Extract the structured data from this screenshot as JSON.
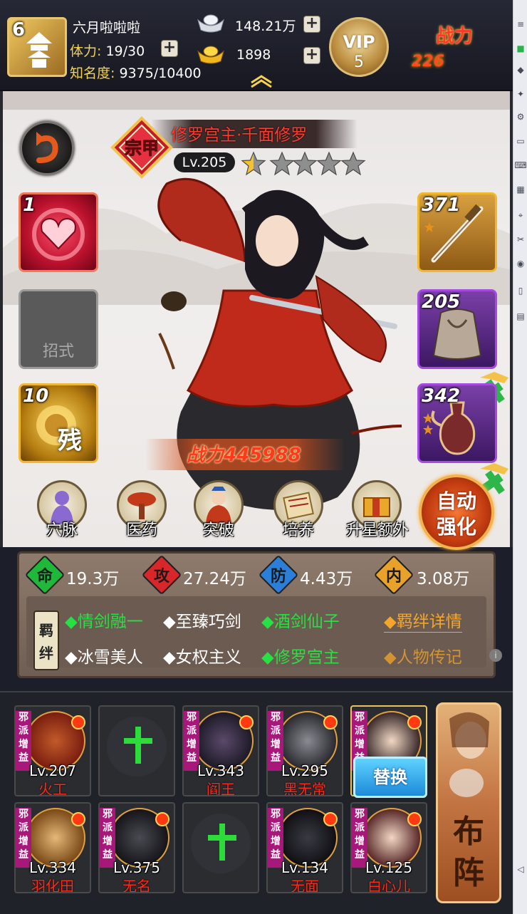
{
  "player": {
    "rank": "6",
    "name": "六月啦啦啦",
    "stamina_label": "体力:",
    "stamina_value": "19/30",
    "fame_label": "知名度:",
    "fame_value": "9375/10400"
  },
  "currency": {
    "silver": "148.21万",
    "gold": "1898"
  },
  "vip": {
    "label": "VIP",
    "level": "5"
  },
  "combat_power": {
    "label": "战力",
    "value": "226"
  },
  "hero": {
    "name": "修罗宫主·千面修罗",
    "class_badge": "宗甲",
    "level": "Lv.205",
    "stars_filled": 1.5,
    "stars_total": 5,
    "power": "战力445988"
  },
  "skills": [
    {
      "num": "1",
      "color": "#e8203c"
    },
    {
      "label": "招式"
    },
    {
      "num": "10",
      "char": "残",
      "color": "#d99a1a"
    }
  ],
  "equipment": [
    {
      "num": "371",
      "color": "#f0b830"
    },
    {
      "num": "205",
      "color": "#a44ae0"
    },
    {
      "num": "342",
      "color": "#a44ae0"
    }
  ],
  "functions": [
    {
      "label": "穴脉",
      "icon": "meridian-icon"
    },
    {
      "label": "医药",
      "icon": "medicine-icon"
    },
    {
      "label": "突破",
      "icon": "breakthrough-icon"
    },
    {
      "label": "培养",
      "icon": "cultivate-icon"
    },
    {
      "label": "升星额外",
      "icon": "star-up-icon"
    }
  ],
  "auto_strengthen": {
    "line1": "自动",
    "line2": "强化"
  },
  "stats": [
    {
      "char": "命",
      "value": "19.3万",
      "color": "#1fb83a"
    },
    {
      "char": "攻",
      "value": "27.24万",
      "color": "#d8262a"
    },
    {
      "char": "防",
      "value": "4.43万",
      "color": "#2b7fd8"
    },
    {
      "char": "内",
      "value": "3.08万",
      "color": "#e8a22a"
    }
  ],
  "bonds": {
    "tag": "羁绊",
    "items": [
      {
        "text": "◆情剑融一",
        "active": true
      },
      {
        "text": "◆至臻巧剑",
        "active": false
      },
      {
        "text": "◆酒剑仙子",
        "active": true
      },
      {
        "text": "◆冰雪美人",
        "active": false
      },
      {
        "text": "◆女权主义",
        "active": false
      },
      {
        "text": "◆修罗宫主",
        "active": true
      }
    ],
    "detail_link": "◆羁绊详情",
    "bio_link": "◆人物传记"
  },
  "roster": {
    "faction": "邪派增益",
    "replace_label": "替换",
    "formation_label": "布阵",
    "heroes": [
      {
        "level": "Lv.207",
        "name": "火工"
      },
      {
        "level": "Lv.343",
        "name": "阎王"
      },
      {
        "level": "Lv.295",
        "name": "黑无常"
      },
      {
        "level": "Lv.334",
        "name": "羽化田"
      },
      {
        "level": "Lv.375",
        "name": "无名"
      },
      {
        "level": "Lv.134",
        "name": "无面"
      },
      {
        "level": "Lv.125",
        "name": "白心儿"
      }
    ]
  }
}
